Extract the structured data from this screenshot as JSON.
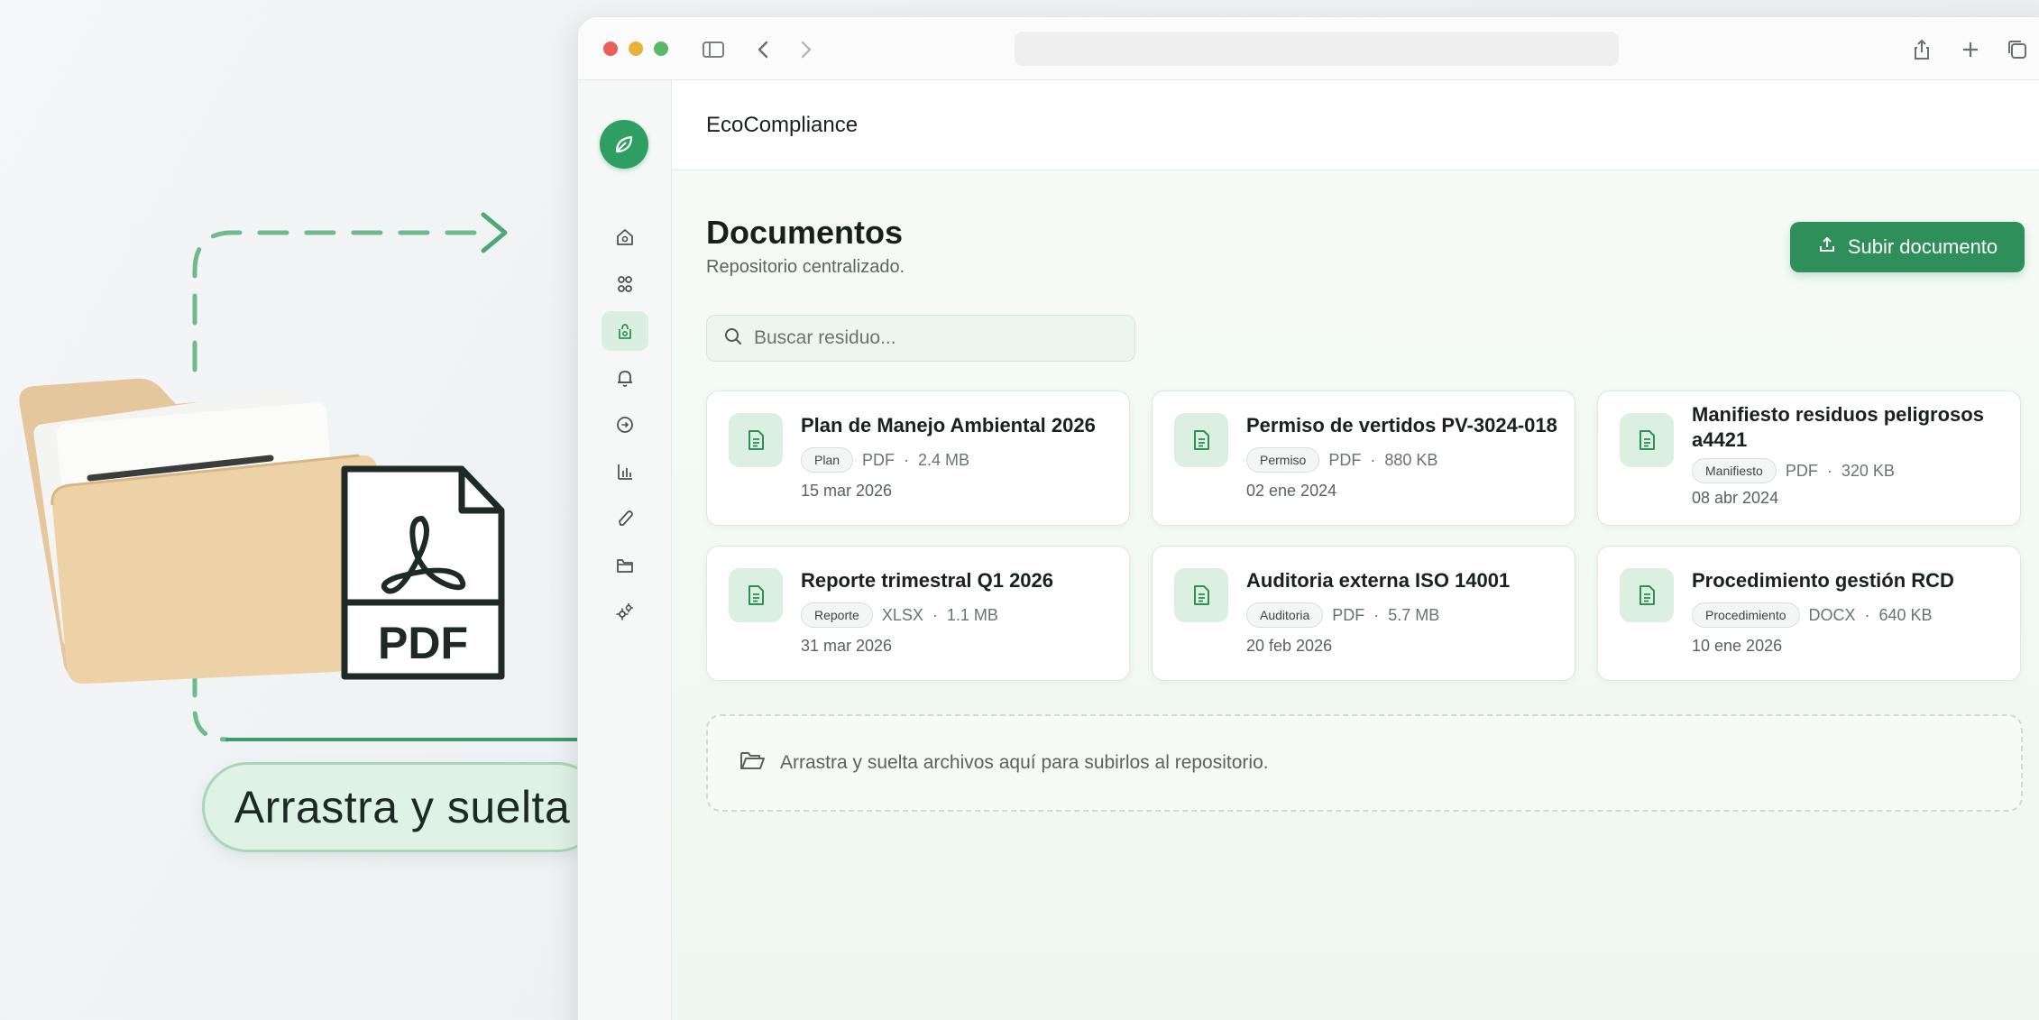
{
  "illustration": {
    "drag_drop_label": "Arrastra y suelta",
    "pdf_label": "PDF",
    "icons": [
      "folder-icon",
      "pdf-file-icon",
      "dashed-arrow-icon",
      "arrow-icon"
    ]
  },
  "window": {
    "address": "",
    "titlebar_icons": [
      "sidebar-toggle-icon",
      "back-icon",
      "forward-icon",
      "share-icon",
      "new-tab-icon",
      "tabs-icon"
    ]
  },
  "app": {
    "name": "EcoCompliance",
    "accent": "#2e8f5a",
    "logo_icon": "leaf-icon"
  },
  "sidebar": {
    "items": [
      {
        "icon": "home-icon",
        "active": false
      },
      {
        "icon": "grid-icon",
        "active": false
      },
      {
        "icon": "recycle-icon",
        "active": true
      },
      {
        "icon": "bell-icon",
        "active": false
      },
      {
        "icon": "document-icon",
        "active": false
      },
      {
        "icon": "chart-icon",
        "active": false
      },
      {
        "icon": "pen-icon",
        "active": false
      },
      {
        "icon": "folder-icon",
        "active": false
      },
      {
        "icon": "settings-icon",
        "active": false
      }
    ]
  },
  "page": {
    "title": "Documentos",
    "subtitle": "Repositorio centralizado.",
    "upload_label": "Subir documento",
    "search_placeholder": "Buscar residuo..."
  },
  "documents": [
    {
      "title": "Plan de Manejo Ambiental 2026",
      "tag": "Plan",
      "type": "PDF",
      "size": "2.4 MB",
      "date": "15 mar 2026"
    },
    {
      "title": "Permiso de vertidos PV-3024-018",
      "tag": "Permiso",
      "type": "PDF",
      "size": "880 KB",
      "date": "02 ene 2024"
    },
    {
      "title": "Manifiesto residuos peligrosos a4421",
      "tag": "Manifiesto",
      "type": "PDF",
      "size": "320 KB",
      "date": "08 abr 2024"
    },
    {
      "title": "Reporte trimestral Q1 2026",
      "tag": "Reporte",
      "type": "XLSX",
      "size": "1.1 MB",
      "date": "31 mar 2026"
    },
    {
      "title": "Auditoria externa ISO 14001",
      "tag": "Auditoria",
      "type": "PDF",
      "size": "5.7 MB",
      "date": "20 feb 2026"
    },
    {
      "title": "Procedimiento gestión RCD",
      "tag": "Procedimiento",
      "type": "DOCX",
      "size": "640 KB",
      "date": "10 ene 2026"
    }
  ],
  "dropzone": {
    "text": "Arrastra y suelta archivos aquí para subirlos al repositorio."
  }
}
